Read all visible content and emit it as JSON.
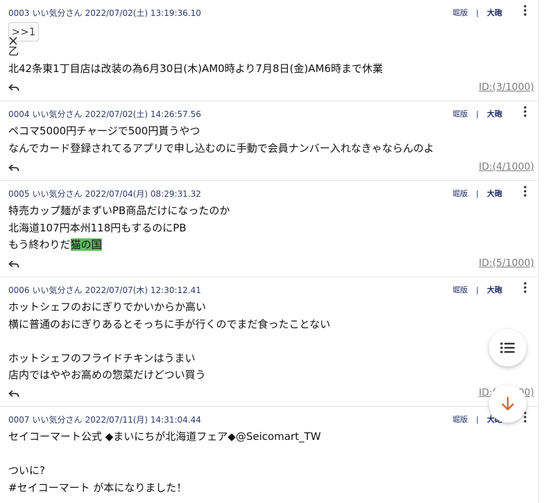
{
  "header_links": {
    "sakaban": "堀版",
    "separator": "|",
    "taiho": "大砲"
  },
  "posts": [
    {
      "number": "0003",
      "name": "いい気分さん",
      "datetime": "2022/07/02(土) 13:19:36.10",
      "anchor": ">>1",
      "lines": [
        "乙",
        "北42条東1丁目店は改装の為6月30日(木)AM0時より7月8日(金)AM6時まで休業"
      ],
      "id": "ID:(3/1000)"
    },
    {
      "number": "0004",
      "name": "いい気分さん",
      "datetime": "2022/07/02(土) 14:26:57.56",
      "lines": [
        "ペコマ5000円チャージで500円貰うやつ",
        "なんでカード登録されてるアプリで申し込むのに手動で会員ナンバー入れなきゃならんのよ"
      ],
      "id": "ID:(4/1000)"
    },
    {
      "number": "0005",
      "name": "いい気分さん",
      "datetime": "2022/07/04(月) 08:29:31.32",
      "lines": [
        "特売カップ麺がまずいPB商品だけになったのか",
        "北海道107円本州118円もするのにPB"
      ],
      "last_line_prefix": "もう終わりだ",
      "last_line_highlight": "猫の国",
      "id": "ID:(5/1000)"
    },
    {
      "number": "0006",
      "name": "いい気分さん",
      "datetime": "2022/07/07(木) 12:30:12.41",
      "lines": [
        "ホットシェフのおにぎりでかいからか高い",
        "横に普通のおにぎりあるとそっちに手が行くのでまだ食ったことない",
        "",
        "ホットシェフのフライドチキンはうまい",
        "店内ではややお高めの惣菜だけどつい買う"
      ],
      "id": "ID:(6/1000)"
    },
    {
      "number": "0007",
      "name": "いい気分さん",
      "datetime": "2022/07/11(月) 14:31:04.44",
      "lines": [
        "セイコーマート公式 ◆まいにちが北海道フェア◆@Seicomart_TW",
        "",
        "ついに?",
        "#セイコーマート が本になりました！"
      ]
    }
  ],
  "icons": {
    "more": "more-vertical-icon",
    "reply": "reply-arrow-icon",
    "close": "close-x-icon",
    "list_fab": "list-icon",
    "down_fab": "arrow-down-icon"
  },
  "colors": {
    "header_text": "#2d3a6c",
    "highlight": "#5cbf5c",
    "id_text": "#7c7c7c",
    "fab_arrow": "#d4681e"
  }
}
